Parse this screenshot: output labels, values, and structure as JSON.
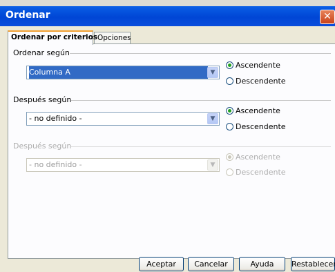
{
  "window": {
    "title": "Ordenar",
    "close_glyph": "✕"
  },
  "tabs": [
    {
      "label": "Ordenar por criterios",
      "active": true
    },
    {
      "label": "Opciones",
      "active": false
    }
  ],
  "groups": [
    {
      "label": "Ordenar según",
      "value": "Columna A",
      "enabled": true,
      "asc_label": "Ascendente",
      "desc_label": "Descendente",
      "selected": "asc"
    },
    {
      "label": "Después según",
      "value": "- no definido -",
      "enabled": true,
      "asc_label": "Ascendente",
      "desc_label": "Descendente",
      "selected": "asc"
    },
    {
      "label": "Después según",
      "value": "- no definido -",
      "enabled": false,
      "asc_label": "Ascendente",
      "desc_label": "Descendente",
      "selected": "asc"
    }
  ],
  "buttons": {
    "ok": "Aceptar",
    "cancel": "Cancelar",
    "help": "Ayuda",
    "reset": "Restablecer"
  },
  "icons": {
    "dropdown": "chevron-down-icon",
    "close": "close-icon"
  }
}
